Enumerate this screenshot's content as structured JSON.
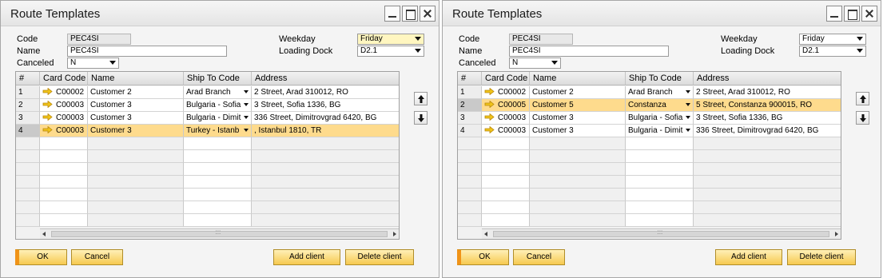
{
  "windows": [
    {
      "title": "Route Templates",
      "fields": {
        "code_label": "Code",
        "code_value": "PEC4SI",
        "name_label": "Name",
        "name_value": "PEC4SI",
        "canceled_label": "Canceled",
        "canceled_value": "N",
        "weekday_label": "Weekday",
        "weekday_value": "Friday",
        "loading_dock_label": "Loading Dock",
        "loading_dock_value": "D2.1"
      },
      "columns": [
        "#",
        "Card Code",
        "Name",
        "Ship To Code",
        "Address"
      ],
      "rows": [
        {
          "num": "1",
          "card_code": "C00002",
          "name": "Customer 2",
          "ship_to": "Arad Branch",
          "address": "2 Street, Arad    310012, RO"
        },
        {
          "num": "2",
          "card_code": "C00003",
          "name": "Customer 3",
          "ship_to": "Bulgaria - Sofia",
          "address": "3 Street, Sofia    1336, BG"
        },
        {
          "num": "3",
          "card_code": "C00003",
          "name": "Customer 3",
          "ship_to": "Bulgaria - Dimit",
          "address": "336 Street, Dimitrovgrad    6420, BG"
        },
        {
          "num": "4",
          "card_code": "C00003",
          "name": "Customer 3",
          "ship_to": "Turkey - Istanb",
          "address": ", Istanbul  1810, TR"
        }
      ],
      "selected_row": 3,
      "buttons": {
        "ok": "OK",
        "cancel": "Cancel",
        "add_client": "Add client",
        "delete_client": "Delete client"
      }
    },
    {
      "title": "Route Templates",
      "fields": {
        "code_label": "Code",
        "code_value": "PEC4SI",
        "name_label": "Name",
        "name_value": "PEC4SI",
        "canceled_label": "Canceled",
        "canceled_value": "N",
        "weekday_label": "Weekday",
        "weekday_value": "Friday",
        "loading_dock_label": "Loading Dock",
        "loading_dock_value": "D2.1"
      },
      "columns": [
        "#",
        "Card Code",
        "Name",
        "Ship To Code",
        "Address"
      ],
      "rows": [
        {
          "num": "1",
          "card_code": "C00002",
          "name": "Customer 2",
          "ship_to": "Arad Branch",
          "address": "2 Street, Arad    310012, RO"
        },
        {
          "num": "2",
          "card_code": "C00005",
          "name": "Customer 5",
          "ship_to": "Constanza",
          "address": "5 Street, Constanza    900015, RO"
        },
        {
          "num": "3",
          "card_code": "C00003",
          "name": "Customer 3",
          "ship_to": "Bulgaria - Sofia",
          "address": "3 Street, Sofia    1336, BG"
        },
        {
          "num": "4",
          "card_code": "C00003",
          "name": "Customer 3",
          "ship_to": "Bulgaria - Dimit",
          "address": "336 Street, Dimitrovgrad    6420, BG"
        }
      ],
      "selected_row": 1,
      "buttons": {
        "ok": "OK",
        "cancel": "Cancel",
        "add_client": "Add client",
        "delete_client": "Delete client"
      }
    }
  ],
  "colors": {
    "selected_row": "#fedb8d",
    "button": "#f6c94f",
    "highlight_field": "#fff6c0"
  }
}
